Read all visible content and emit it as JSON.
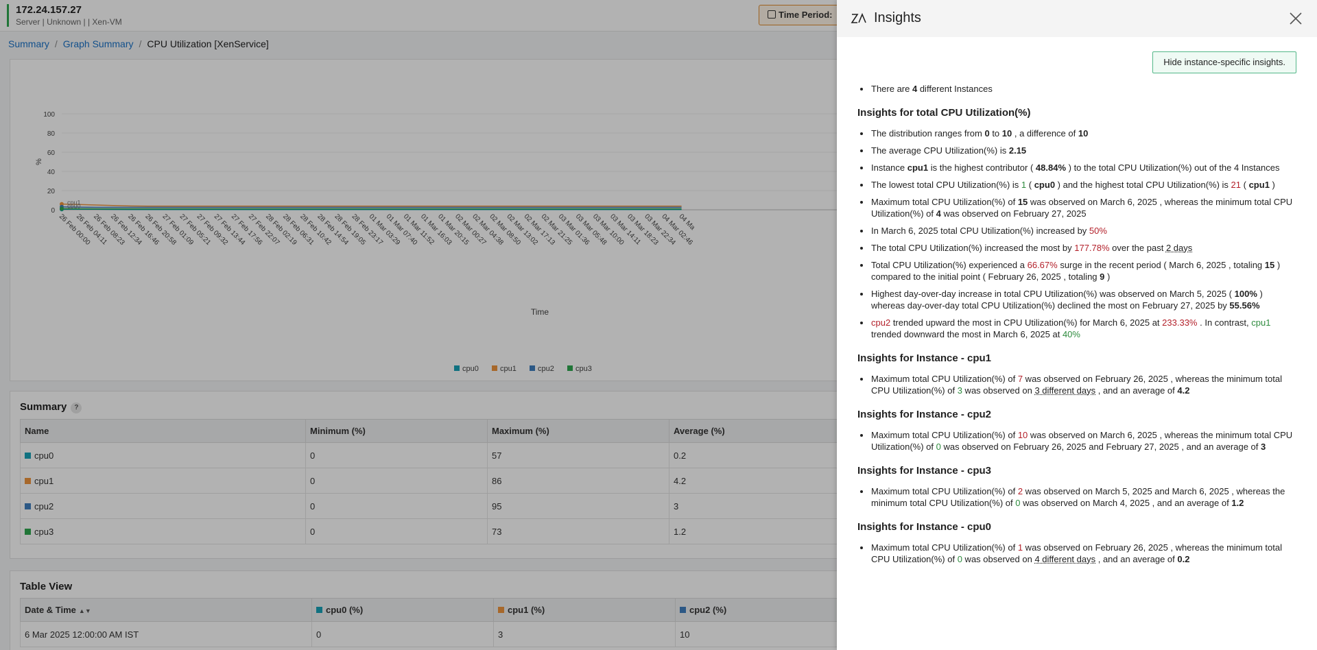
{
  "header": {
    "ip": "172.24.157.27",
    "meta": "Server | Unknown |  | Xen-VM",
    "time_period_label": "Time Period:"
  },
  "breadcrumb": {
    "summary": "Summary",
    "graph_summary": "Graph Summary",
    "current": "CPU Utilization [XenService]"
  },
  "colors": {
    "cpu0": "#17a2b8",
    "cpu1": "#f0963e",
    "cpu2": "#3f7fbf",
    "cpu3": "#2ea84f",
    "accent_green": "#2fa84f"
  },
  "chart_data": {
    "type": "line",
    "title": "",
    "xlabel": "Time",
    "ylabel": "%",
    "ylim": [
      0,
      100
    ],
    "yticks": [
      "100",
      "80",
      "60",
      "40",
      "20",
      "0"
    ],
    "categories": [
      "26 Feb 00:00",
      "26 Feb 04:11",
      "26 Feb 08:23",
      "26 Feb 12:34",
      "26 Feb 16:46",
      "26 Feb 20:58",
      "27 Feb 01:09",
      "27 Feb 05:21",
      "27 Feb 09:32",
      "27 Feb 13:44",
      "27 Feb 17:56",
      "27 Feb 22:07",
      "28 Feb 02:19",
      "28 Feb 06:31",
      "28 Feb 10:42",
      "28 Feb 14:54",
      "28 Feb 19:05",
      "28 Feb 23:17",
      "01 Mar 03:29",
      "01 Mar 07:40",
      "01 Mar 11:52",
      "01 Mar 16:03",
      "01 Mar 20:15",
      "02 Mar 00:27",
      "02 Mar 04:38",
      "02 Mar 08:50",
      "02 Mar 13:02",
      "02 Mar 17:13",
      "02 Mar 21:25",
      "03 Mar 01:36",
      "03 Mar 05:48",
      "03 Mar 10:00",
      "03 Mar 14:11",
      "03 Mar 18:23",
      "03 Mar 22:34",
      "04 Mar 02:46",
      "04 Ma"
    ],
    "series": [
      {
        "name": "cpu0",
        "values": [
          0.5,
          0.5,
          0.5,
          0.4,
          0.3,
          0.3,
          0.3,
          0.3,
          0.3,
          0.3,
          0.3,
          0.3,
          0.3,
          0.3,
          0.3,
          0.3,
          0.3,
          0.3,
          0.3,
          0.3,
          0.3,
          0.3,
          0.3,
          0.3,
          0.3,
          0.3,
          0.3,
          0.3,
          0.3,
          0.3,
          0.3,
          0.3,
          0.3,
          0.3,
          0.3,
          0.3,
          0.3
        ]
      },
      {
        "name": "cpu1",
        "values": [
          6,
          5.5,
          5,
          4.5,
          4,
          3.8,
          3.8,
          3.8,
          3.8,
          3.8,
          3.8,
          3.8,
          3.8,
          3.8,
          3.8,
          3.8,
          3.8,
          3.8,
          3.8,
          3.8,
          3.8,
          3.8,
          3.8,
          3.8,
          3.8,
          3.8,
          3.8,
          3.8,
          3.8,
          3.8,
          3.8,
          3.8,
          3.8,
          3.8,
          3.8,
          3.8,
          3.8
        ]
      },
      {
        "name": "cpu2",
        "values": [
          3,
          2.8,
          2.6,
          2.6,
          2.6,
          2.6,
          2.6,
          2.6,
          2.6,
          2.6,
          2.6,
          2.6,
          2.6,
          2.6,
          2.6,
          2.6,
          2.6,
          2.6,
          2.6,
          2.6,
          2.6,
          2.6,
          2.6,
          2.6,
          2.6,
          2.6,
          2.6,
          2.6,
          2.6,
          2.6,
          2.6,
          2.6,
          2.6,
          2.6,
          2.6,
          2.6,
          2.6
        ]
      },
      {
        "name": "cpu3",
        "values": [
          1.2,
          1.1,
          1.0,
          1.0,
          1.0,
          1.0,
          1.0,
          1.0,
          1.0,
          1.0,
          1.0,
          1.0,
          1.0,
          1.0,
          1.0,
          1.0,
          1.0,
          1.0,
          1.0,
          1.0,
          1.0,
          1.0,
          1.0,
          1.0,
          1.0,
          1.0,
          1.0,
          1.0,
          1.0,
          1.0,
          1.0,
          1.0,
          1.0,
          1.0,
          1.0,
          1.0,
          1.0
        ]
      }
    ],
    "point_labels": [
      "cpu0",
      "cpu1"
    ],
    "legend": [
      "cpu0",
      "cpu1",
      "cpu2",
      "cpu3"
    ],
    "legend_position": "bottom",
    "grid": true
  },
  "summary": {
    "title": "Summary",
    "help": "?",
    "columns": [
      "Name",
      "Minimum (%)",
      "Maximum (%)",
      "Average (%)"
    ],
    "rows": [
      {
        "name": "cpu0",
        "min": "0",
        "max": "57",
        "avg": "0.2"
      },
      {
        "name": "cpu1",
        "min": "0",
        "max": "86",
        "avg": "4.2"
      },
      {
        "name": "cpu2",
        "min": "0",
        "max": "95",
        "avg": "3"
      },
      {
        "name": "cpu3",
        "min": "0",
        "max": "73",
        "avg": "1.2"
      }
    ]
  },
  "tableview": {
    "title": "Table View",
    "columns": [
      "Date & Time",
      "cpu0 (%)",
      "cpu1 (%)",
      "cpu2 (%)"
    ],
    "rows": [
      {
        "date": "6 Mar 2025 12:00:00 AM IST",
        "cpu0": "0",
        "cpu1": "3",
        "cpu2": "10"
      }
    ]
  },
  "insights": {
    "title": "Insights",
    "hide_button": "Hide instance-specific insights.",
    "instances_pre": "There are ",
    "instances_count": "4",
    "instances_post": " different Instances",
    "total_title": "Insights for total CPU Utilization(%)",
    "cpu1_title": "Insights for Instance - cpu1",
    "cpu2_title": "Insights for Instance - cpu2",
    "cpu3_title": "Insights for Instance - cpu3",
    "cpu0_title": "Insights for Instance - cpu0"
  }
}
